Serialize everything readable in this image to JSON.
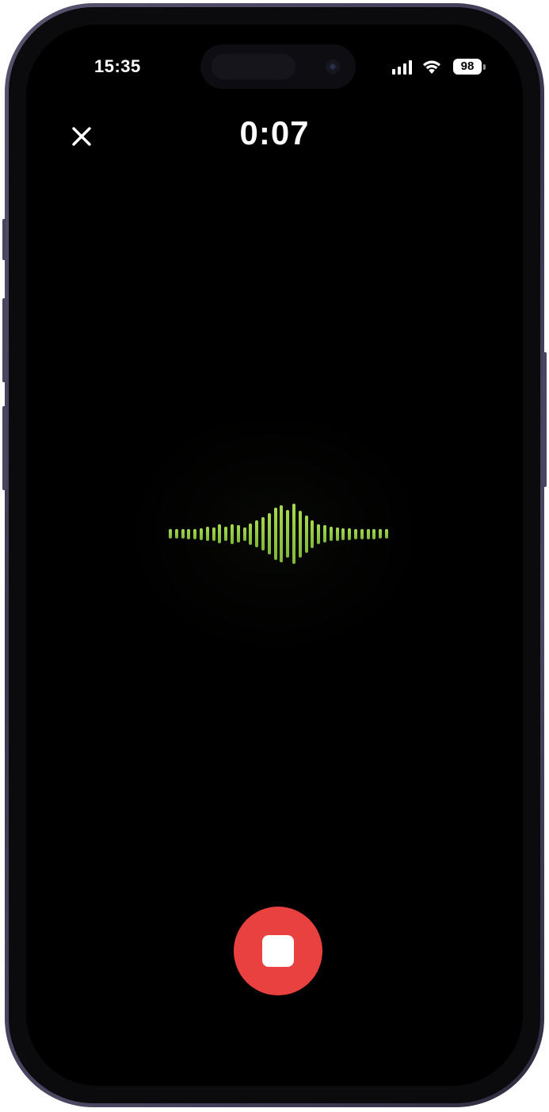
{
  "status_bar": {
    "time": "15:35",
    "battery": "98",
    "signal_icon": "cellular-signal-icon",
    "wifi_icon": "wifi-icon"
  },
  "header": {
    "close_icon": "close-icon",
    "timer": "0:07"
  },
  "waveform": {
    "color": "#8cc63f",
    "levels": [
      0.14,
      0.14,
      0.14,
      0.16,
      0.16,
      0.18,
      0.22,
      0.2,
      0.28,
      0.22,
      0.3,
      0.26,
      0.2,
      0.32,
      0.4,
      0.5,
      0.62,
      0.78,
      0.86,
      0.72,
      0.9,
      0.7,
      0.56,
      0.42,
      0.3,
      0.26,
      0.22,
      0.2,
      0.18,
      0.18,
      0.16,
      0.16,
      0.16,
      0.15,
      0.14,
      0.14
    ]
  },
  "controls": {
    "stop_button_color": "#e8413f",
    "stop_icon": "stop-icon"
  }
}
